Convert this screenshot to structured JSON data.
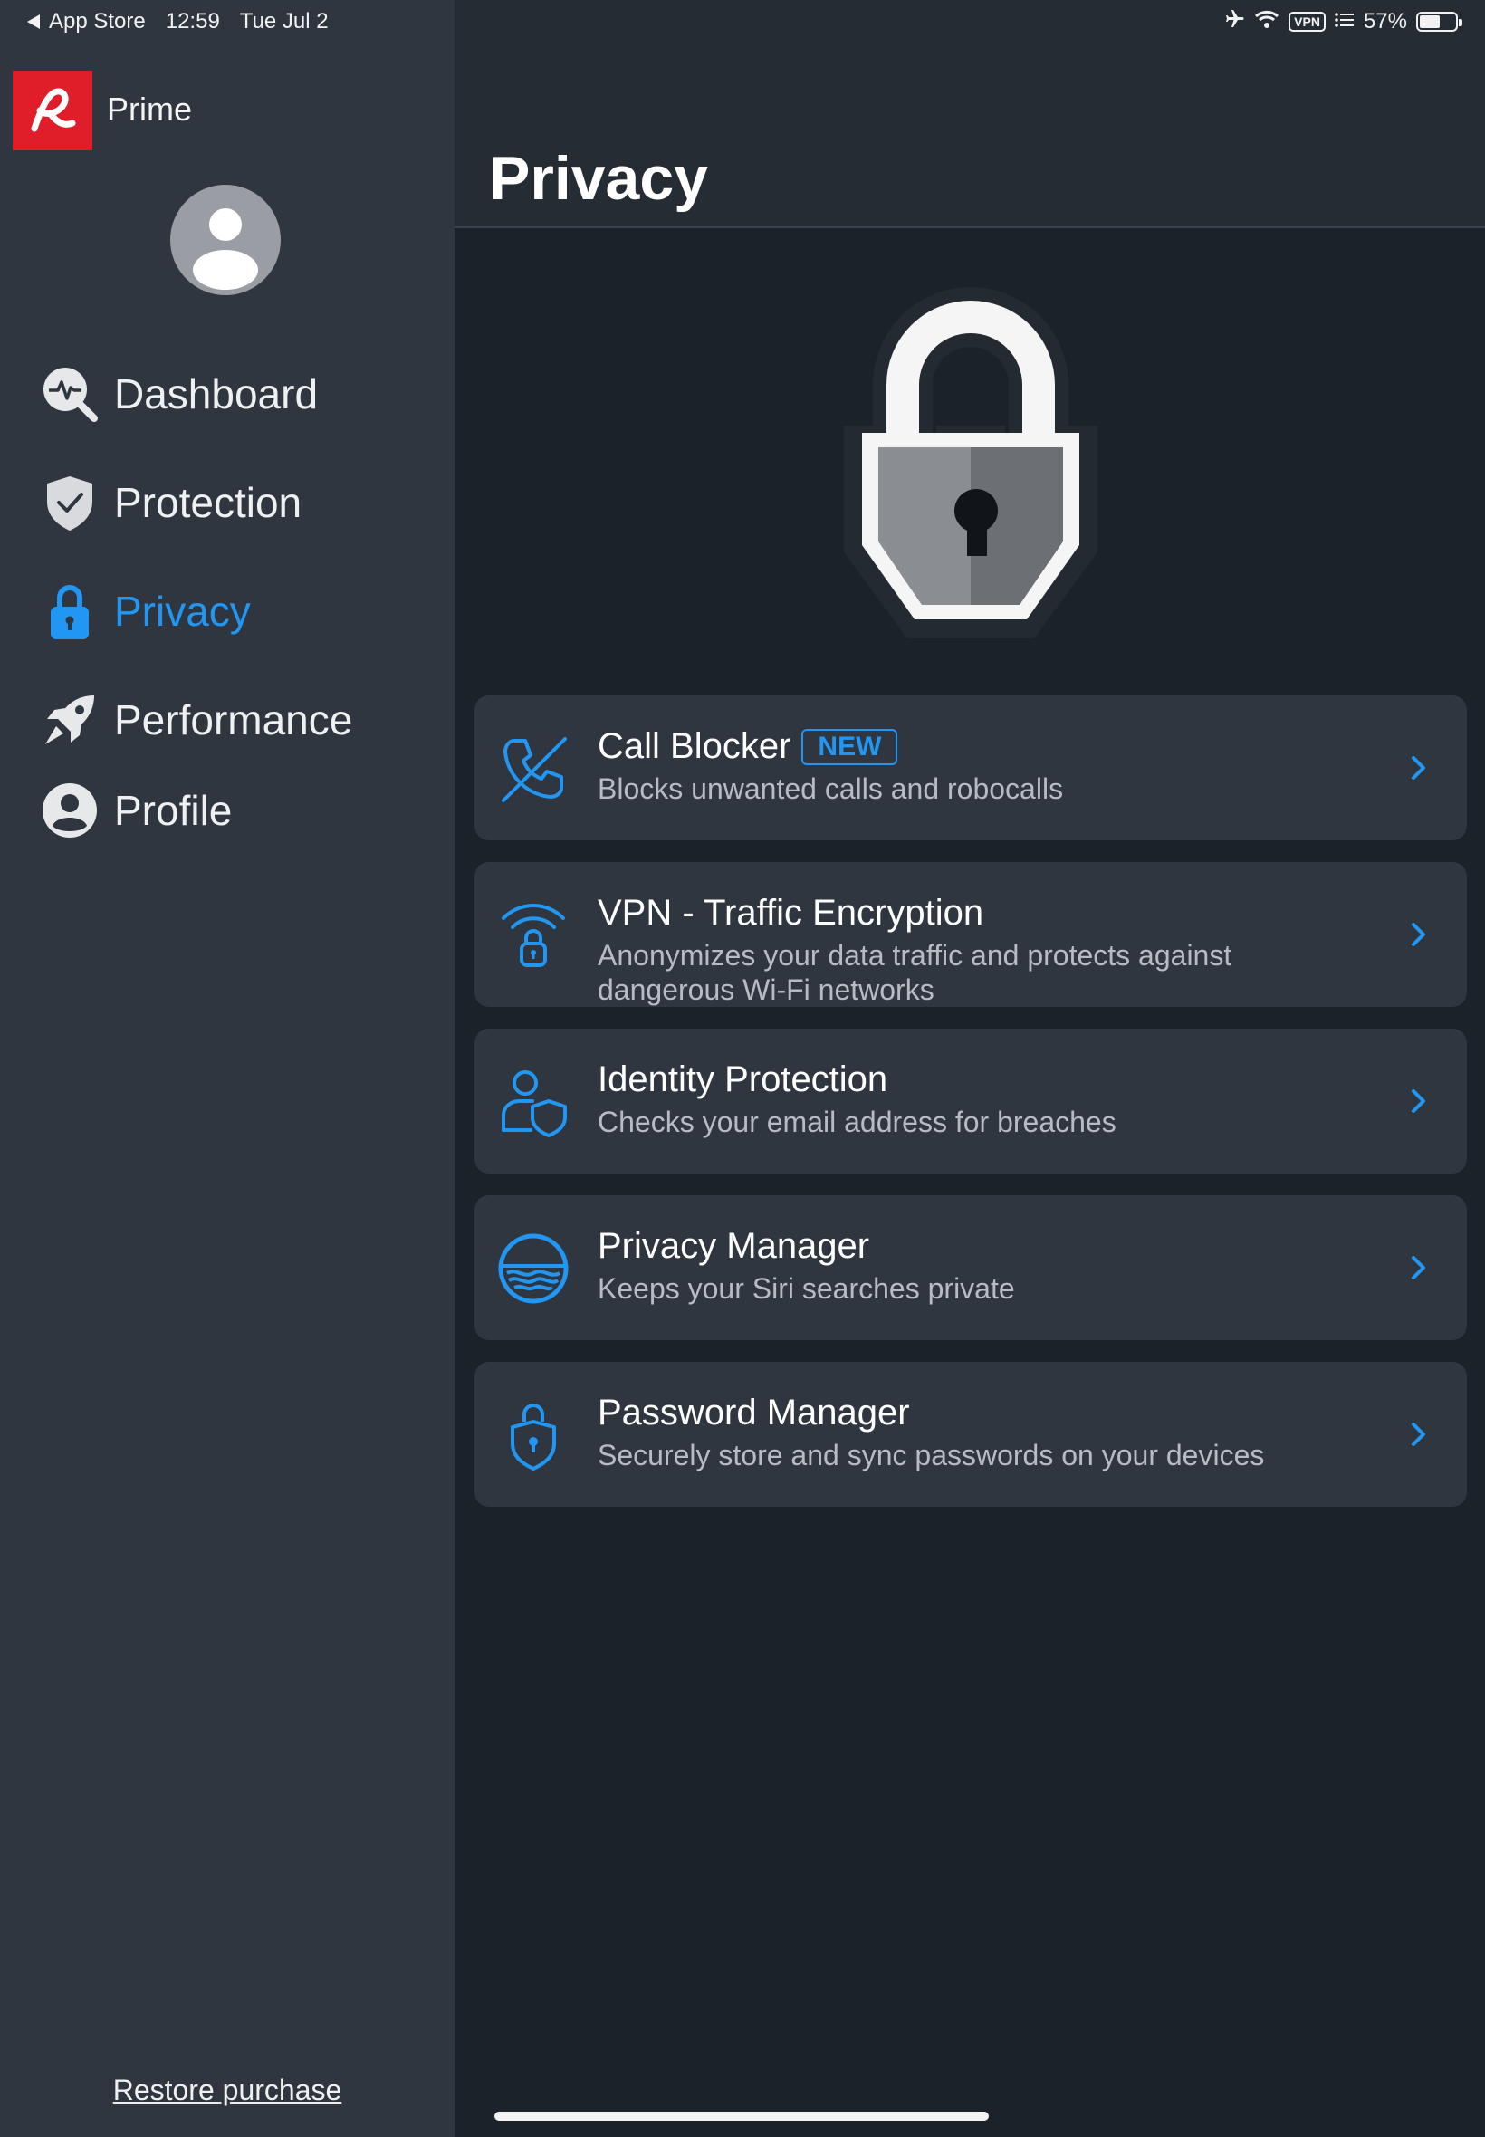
{
  "status_bar": {
    "back_label": "App Store",
    "time": "12:59",
    "date": "Tue Jul 2",
    "vpn_label": "VPN",
    "battery_text": "57%",
    "battery_level": 0.57
  },
  "brand": {
    "name": "Prime",
    "logo_color": "#e01e2a"
  },
  "sidebar": {
    "items": [
      {
        "label": "Dashboard",
        "icon": "dashboard-pulse-icon",
        "active": false
      },
      {
        "label": "Protection",
        "icon": "shield-check-icon",
        "active": false
      },
      {
        "label": "Privacy",
        "icon": "lock-icon",
        "active": true
      },
      {
        "label": "Performance",
        "icon": "rocket-icon",
        "active": false
      },
      {
        "label": "Profile",
        "icon": "person-circle-icon",
        "active": false
      }
    ],
    "restore_label": "Restore purchase"
  },
  "main": {
    "title": "Privacy",
    "hero_icon": "padlock-icon",
    "cards": [
      {
        "title": "Call Blocker",
        "badge": "NEW",
        "desc": "Blocks unwanted calls and robocalls",
        "icon": "phone-blocked-icon"
      },
      {
        "title": "VPN - Traffic Encryption",
        "desc": "Anonymizes your data traffic and protects against dangerous Wi-Fi networks",
        "icon": "wifi-lock-icon"
      },
      {
        "title": "Identity Protection",
        "desc": "Checks your email address for breaches",
        "icon": "person-shield-icon"
      },
      {
        "title": "Privacy Manager",
        "desc": "Keeps your Siri searches private",
        "icon": "siri-globe-icon"
      },
      {
        "title": "Password Manager",
        "desc": "Securely store and sync passwords on your devices",
        "icon": "keyhole-shield-icon"
      }
    ]
  },
  "colors": {
    "accent": "#2196f3",
    "sidebar_bg": "#2f363f",
    "main_bg": "#1c222a",
    "card_bg": "#2f363f"
  }
}
